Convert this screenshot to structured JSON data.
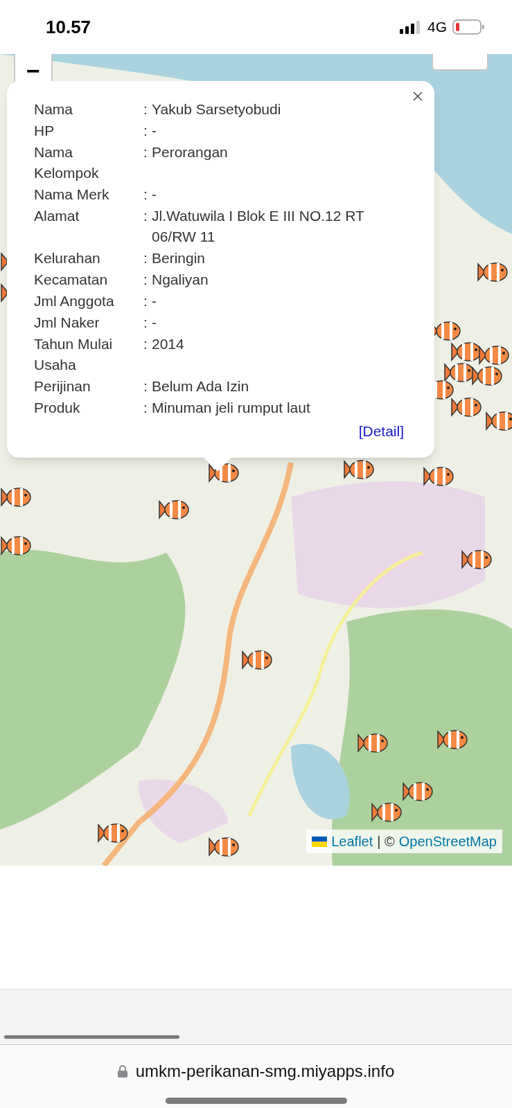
{
  "status_bar": {
    "time": "10.57",
    "network": "4G"
  },
  "map": {
    "zoom_out": "−",
    "attribution": {
      "leaflet": "Leaflet",
      "separator": "| ©",
      "osm": "OpenStreetMap"
    }
  },
  "popup": {
    "fields": [
      {
        "label": "Nama",
        "value": "Yakub Sarsetyobudi"
      },
      {
        "label": "HP",
        "value": "-"
      },
      {
        "label": "Nama Kelompok",
        "value": "Perorangan"
      },
      {
        "label": "Nama Merk",
        "value": "-"
      },
      {
        "label": "Alamat",
        "value": "Jl.Watuwila I Blok E III NO.12 RT 06/RW 11"
      },
      {
        "label": "Kelurahan",
        "value": "Beringin"
      },
      {
        "label": "Kecamatan",
        "value": "Ngaliyan"
      },
      {
        "label": "Jml Anggota",
        "value": "-"
      },
      {
        "label": "Jml Naker",
        "value": "-"
      },
      {
        "label": "Tahun Mulai Usaha",
        "value": "2014"
      },
      {
        "label": "Perijinan",
        "value": "Belum Ada Izin"
      },
      {
        "label": "Produk",
        "value": "Minuman jeli rumput laut"
      }
    ],
    "separator": ":",
    "link": "[Detail]"
  },
  "address_bar": {
    "url": "umkm-perikanan-smg.miyapps.info"
  }
}
